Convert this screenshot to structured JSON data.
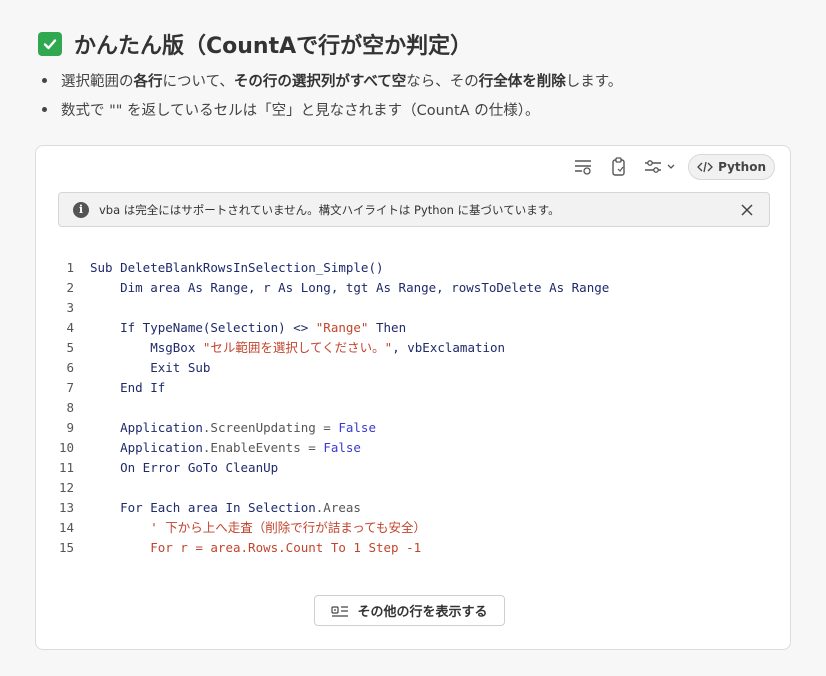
{
  "heading": {
    "title": "かんたん版（CountAで行が空か判定）",
    "icon": "check-box-icon",
    "icon_color": "#2fa84f"
  },
  "bullets": [
    {
      "parts": [
        {
          "text": "選択範囲の",
          "bold": false
        },
        {
          "text": "各行",
          "bold": true
        },
        {
          "text": "について、",
          "bold": false
        },
        {
          "text": "その行の選択列がすべて空",
          "bold": true
        },
        {
          "text": "なら、その",
          "bold": false
        },
        {
          "text": "行全体を削除",
          "bold": true
        },
        {
          "text": "します。",
          "bold": false
        }
      ]
    },
    {
      "parts": [
        {
          "text": "数式で \"\" を返しているセルは「空」と見なされます（CountA の仕様）。",
          "bold": false
        }
      ]
    }
  ],
  "toolbar": {
    "icons": [
      "wrap-text-icon",
      "copy-clipboard-icon",
      "settings-sliders-icon"
    ],
    "language_label": "Python",
    "language_icon": "code-icon"
  },
  "notice": {
    "text": "vba は完全にはサポートされていません。構文ハイライトは Python に基づいています。",
    "icon": "info-icon"
  },
  "code_lines": [
    {
      "n": "1",
      "tokens": [
        [
          "kw",
          "Sub DeleteBlankRowsInSelection_Simple()"
        ]
      ]
    },
    {
      "n": "2",
      "tokens": [
        [
          "kw",
          "    Dim area As Range, r As Long, tgt As Range, rowsToDelete As Range"
        ]
      ]
    },
    {
      "n": "3",
      "tokens": []
    },
    {
      "n": "4",
      "tokens": [
        [
          "kw",
          "    If TypeName(Selection) <> "
        ],
        [
          "str",
          "\"Range\""
        ],
        [
          "kw",
          " Then"
        ]
      ]
    },
    {
      "n": "5",
      "tokens": [
        [
          "kw",
          "        MsgBox "
        ],
        [
          "str",
          "\"セル範囲を選択してください。\""
        ],
        [
          "kw",
          ", vbExclamation"
        ]
      ]
    },
    {
      "n": "6",
      "tokens": [
        [
          "kw",
          "        Exit Sub"
        ]
      ]
    },
    {
      "n": "7",
      "tokens": [
        [
          "kw",
          "    End If"
        ]
      ]
    },
    {
      "n": "8",
      "tokens": []
    },
    {
      "n": "9",
      "tokens": [
        [
          "kw",
          "    Application"
        ],
        [
          "plain",
          ".ScreenUpdating = "
        ],
        [
          "bool",
          "False"
        ]
      ]
    },
    {
      "n": "10",
      "tokens": [
        [
          "kw",
          "    Application"
        ],
        [
          "plain",
          ".EnableEvents = "
        ],
        [
          "bool",
          "False"
        ]
      ]
    },
    {
      "n": "11",
      "tokens": [
        [
          "kw",
          "    On Error GoTo CleanUp"
        ]
      ]
    },
    {
      "n": "12",
      "tokens": []
    },
    {
      "n": "13",
      "tokens": [
        [
          "kw",
          "    For Each area In Selection"
        ],
        [
          "plain",
          ".Areas"
        ]
      ]
    },
    {
      "n": "14",
      "tokens": [
        [
          "comment",
          "        ' 下から上へ走査（削除で行が詰まっても安全）"
        ]
      ]
    },
    {
      "n": "15",
      "tokens": [
        [
          "comment",
          "        For r = area.Rows.Count To 1 Step -1"
        ]
      ]
    }
  ],
  "show_more": {
    "label": "その他の行を表示する",
    "icon": "expand-lines-icon"
  }
}
